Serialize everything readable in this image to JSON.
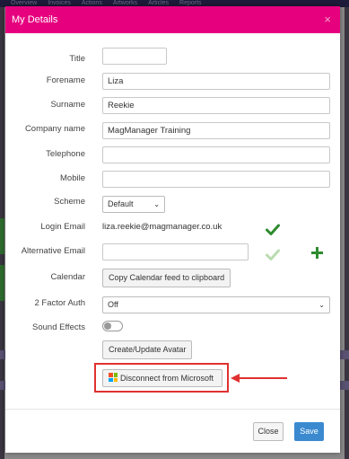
{
  "background": {
    "nav_items": [
      "Overview",
      "Invoices",
      "Actions",
      "Artworks",
      "Articles",
      "Reports"
    ]
  },
  "modal": {
    "title": "My Details",
    "close_icon": "×",
    "header_color": "#e6007e"
  },
  "fields": {
    "title": {
      "label": "Title",
      "value": ""
    },
    "forename": {
      "label": "Forename",
      "value": "Liza"
    },
    "surname": {
      "label": "Surname",
      "value": "Reekie"
    },
    "company_name": {
      "label": "Company name",
      "value": "MagManager Training"
    },
    "telephone": {
      "label": "Telephone",
      "value": ""
    },
    "mobile": {
      "label": "Mobile",
      "value": ""
    },
    "scheme": {
      "label": "Scheme",
      "value": "Default"
    },
    "login_email": {
      "label": "Login Email",
      "value": "liza.reekie@magmanager.co.uk"
    },
    "alternative_email": {
      "label": "Alternative Email",
      "value": ""
    },
    "calendar": {
      "label": "Calendar",
      "button": "Copy Calendar feed to clipboard"
    },
    "two_factor": {
      "label": "2 Factor Auth",
      "value": "Off"
    },
    "sound_effects": {
      "label": "Sound Effects",
      "enabled": false
    }
  },
  "buttons": {
    "avatar": "Create/Update Avatar",
    "disconnect": "Disconnect from Microsoft",
    "close": "Close",
    "save": "Save"
  },
  "colors": {
    "verified_check": "#2e8b2e",
    "pending_check": "#b9dcb0",
    "add_plus": "#2e8b2e",
    "annotation_red": "#e03030",
    "save_blue": "#3b8ad0"
  }
}
